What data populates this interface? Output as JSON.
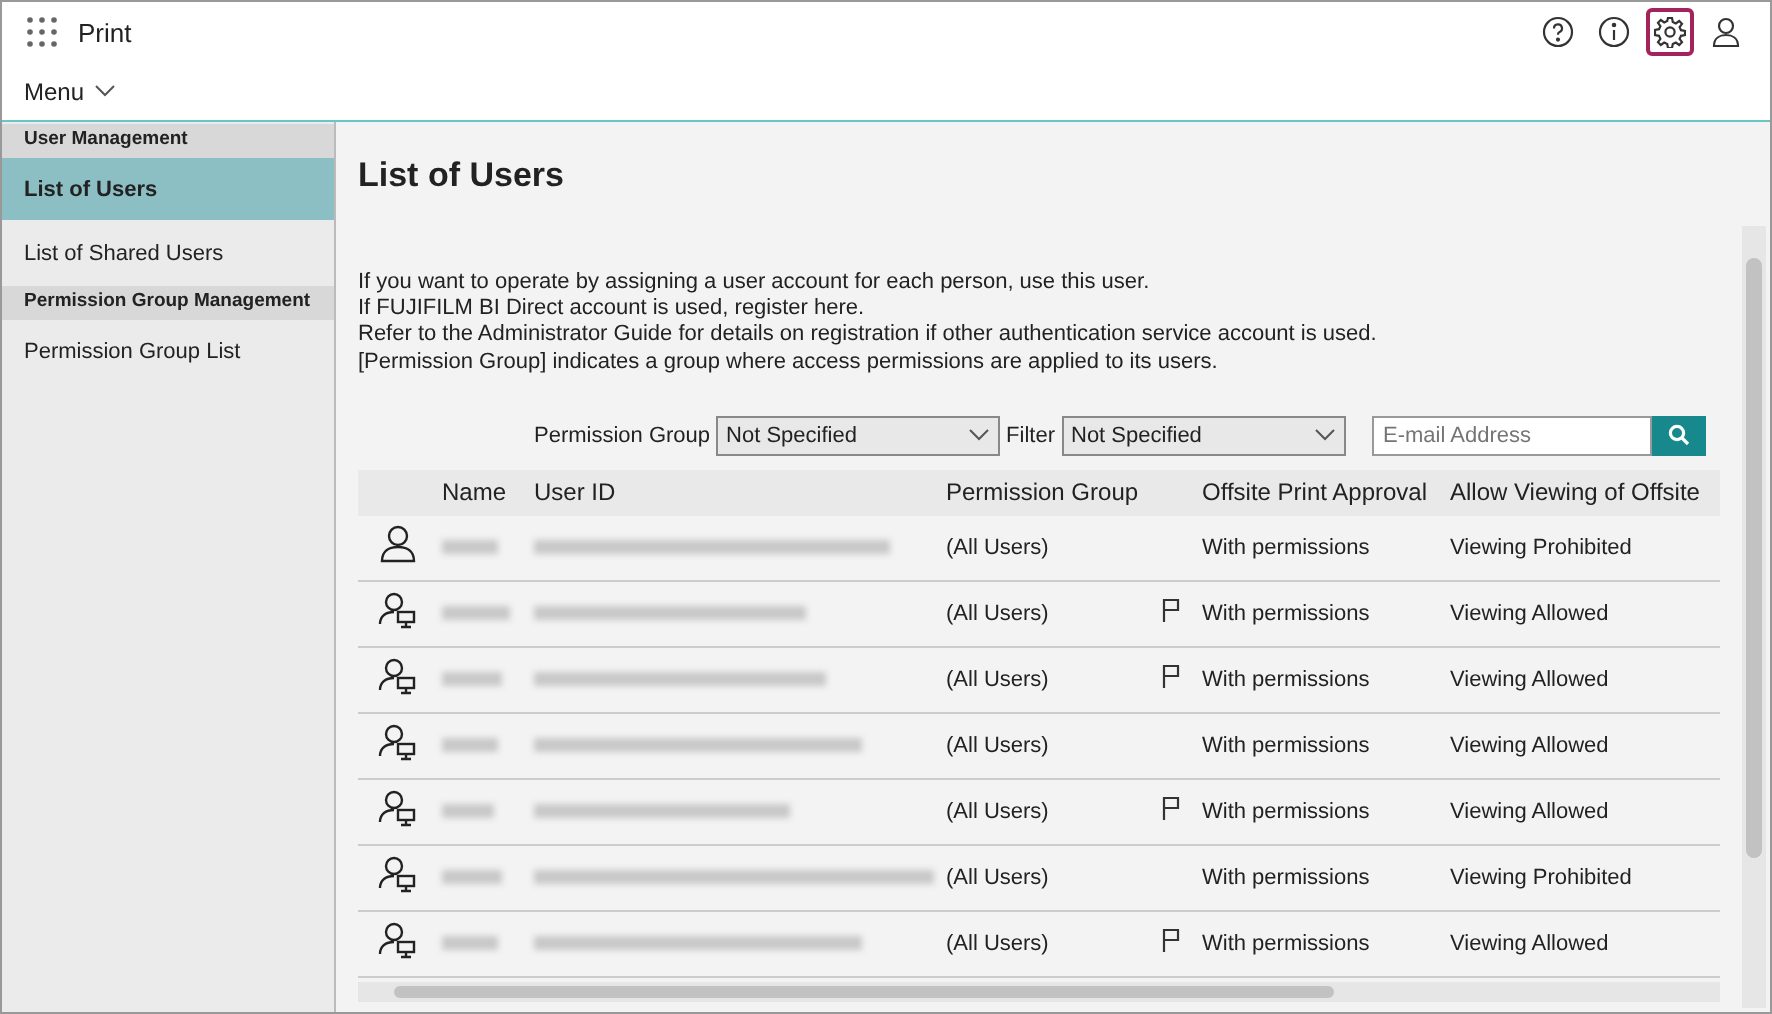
{
  "app_bar": {
    "title": "Print"
  },
  "menu": {
    "label": "Menu"
  },
  "sidebar": {
    "sections": [
      {
        "heading": "User Management",
        "items": [
          {
            "label": "List of Users",
            "selected": true
          },
          {
            "label": "List of Shared Users",
            "selected": false
          }
        ]
      },
      {
        "heading": "Permission Group Management",
        "items": [
          {
            "label": "Permission Group List",
            "selected": false
          }
        ]
      }
    ]
  },
  "page": {
    "title": "List of Users",
    "description": [
      "If you want to operate by assigning a user account for each person, use this user.",
      "If FUJIFILM BI Direct account is used, register here.",
      "Refer to the Administrator Guide for details on registration if other authentication service account is used.",
      "[Permission Group] indicates a group where access permissions are applied to its users."
    ]
  },
  "filters": {
    "permission_group": {
      "label": "Permission Group",
      "value": "Not Specified"
    },
    "filter": {
      "label": "Filter",
      "value": "Not Specified"
    },
    "email": {
      "placeholder": "E-mail Address"
    }
  },
  "table": {
    "columns": [
      "Name",
      "User ID",
      "Permission Group",
      "Offsite Print Approval",
      "Allow Viewing of Offsite"
    ],
    "rows": [
      {
        "kind": "person",
        "permission_group": "(All Users)",
        "flagged": false,
        "offsite_print_approval": "With permissions",
        "allow_viewing": "Viewing Prohibited"
      },
      {
        "kind": "shared",
        "permission_group": "(All Users)",
        "flagged": true,
        "offsite_print_approval": "With permissions",
        "allow_viewing": "Viewing Allowed"
      },
      {
        "kind": "shared",
        "permission_group": "(All Users)",
        "flagged": true,
        "offsite_print_approval": "With permissions",
        "allow_viewing": "Viewing Allowed"
      },
      {
        "kind": "shared",
        "permission_group": "(All Users)",
        "flagged": false,
        "offsite_print_approval": "With permissions",
        "allow_viewing": "Viewing Allowed"
      },
      {
        "kind": "shared",
        "permission_group": "(All Users)",
        "flagged": true,
        "offsite_print_approval": "With permissions",
        "allow_viewing": "Viewing Allowed"
      },
      {
        "kind": "shared",
        "permission_group": "(All Users)",
        "flagged": false,
        "offsite_print_approval": "With permissions",
        "allow_viewing": "Viewing Prohibited"
      },
      {
        "kind": "shared",
        "permission_group": "(All Users)",
        "flagged": true,
        "offsite_print_approval": "With permissions",
        "allow_viewing": "Viewing Allowed"
      }
    ]
  }
}
